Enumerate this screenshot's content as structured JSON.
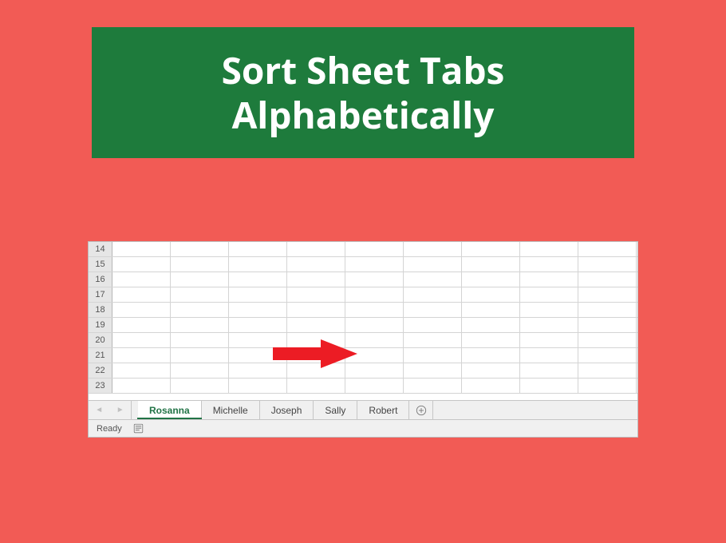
{
  "banner": {
    "title": "Sort Sheet Tabs Alphabetically"
  },
  "grid": {
    "row_start": 14,
    "row_end": 23,
    "col_count": 9
  },
  "tabs": [
    {
      "label": "Rosanna",
      "active": true
    },
    {
      "label": "Michelle",
      "active": false
    },
    {
      "label": "Joseph",
      "active": false
    },
    {
      "label": "Sally",
      "active": false
    },
    {
      "label": "Robert",
      "active": false
    }
  ],
  "status": {
    "text": "Ready"
  },
  "colors": {
    "background": "#f25b55",
    "banner": "#1e7b3c",
    "excel_accent": "#217346",
    "arrow": "#ec1c24"
  }
}
